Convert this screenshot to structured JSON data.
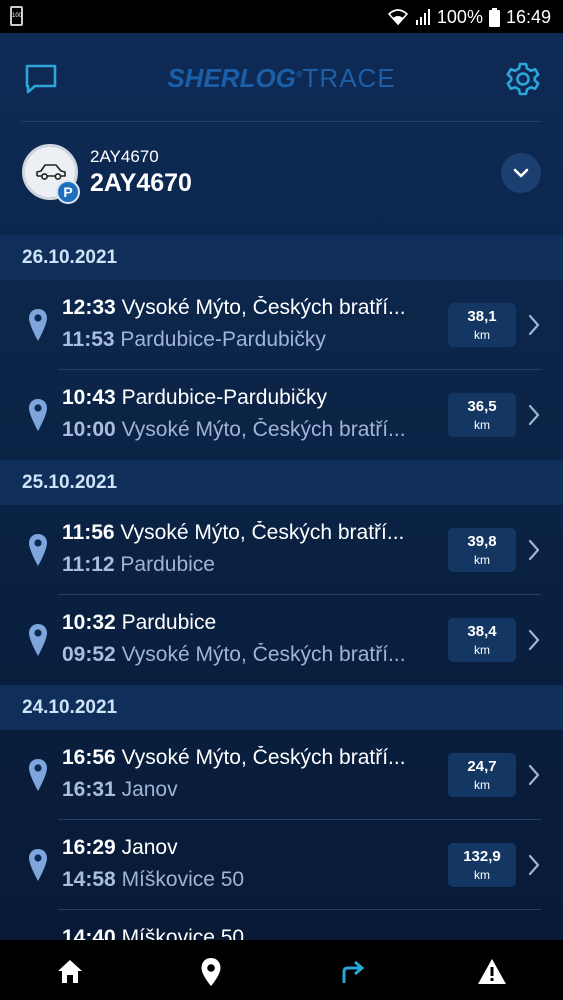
{
  "statusbar": {
    "battery_small_label": "100",
    "battery_percent": "100%",
    "time": "16:49"
  },
  "header": {
    "logo_bold": "SHERLOG",
    "logo_reg": "®",
    "logo_thin": "TRACE"
  },
  "vehicle": {
    "plate_small": "2AY4670",
    "plate_big": "2AY4670",
    "badge": "P"
  },
  "colors": {
    "accent": "#2aa6d8",
    "pin": "#7ea6dc",
    "secondary_text": "#9fb4d6"
  },
  "groups": [
    {
      "date": "26.10.2021",
      "trips": [
        {
          "end_time": "12:33",
          "end_place": "Vysoké Mýto, Českých bratří...",
          "start_time": "11:53",
          "start_place": "Pardubice-Pardubičky",
          "distance": "38,1",
          "unit": "km"
        },
        {
          "end_time": "10:43",
          "end_place": "Pardubice-Pardubičky",
          "start_time": "10:00",
          "start_place": "Vysoké Mýto, Českých bratří...",
          "distance": "36,5",
          "unit": "km"
        }
      ]
    },
    {
      "date": "25.10.2021",
      "trips": [
        {
          "end_time": "11:56",
          "end_place": "Vysoké Mýto, Českých bratří...",
          "start_time": "11:12",
          "start_place": "Pardubice",
          "distance": "39,8",
          "unit": "km"
        },
        {
          "end_time": "10:32",
          "end_place": "Pardubice",
          "start_time": "09:52",
          "start_place": "Vysoké Mýto, Českých bratří...",
          "distance": "38,4",
          "unit": "km"
        }
      ]
    },
    {
      "date": "24.10.2021",
      "trips": [
        {
          "end_time": "16:56",
          "end_place": "Vysoké Mýto, Českých bratří...",
          "start_time": "16:31",
          "start_place": "Janov",
          "distance": "24,7",
          "unit": "km"
        },
        {
          "end_time": "16:29",
          "end_place": "Janov",
          "start_time": "14:58",
          "start_place": "Míškovice 50",
          "distance": "132,9",
          "unit": "km"
        },
        {
          "end_time": "14:40",
          "end_place": "Míškovice 50",
          "start_time": "",
          "start_place": "",
          "distance": "",
          "unit": ""
        }
      ]
    }
  ],
  "nav": [
    "home-icon",
    "location-pin-icon",
    "trips-arrow-icon",
    "warning-icon"
  ]
}
